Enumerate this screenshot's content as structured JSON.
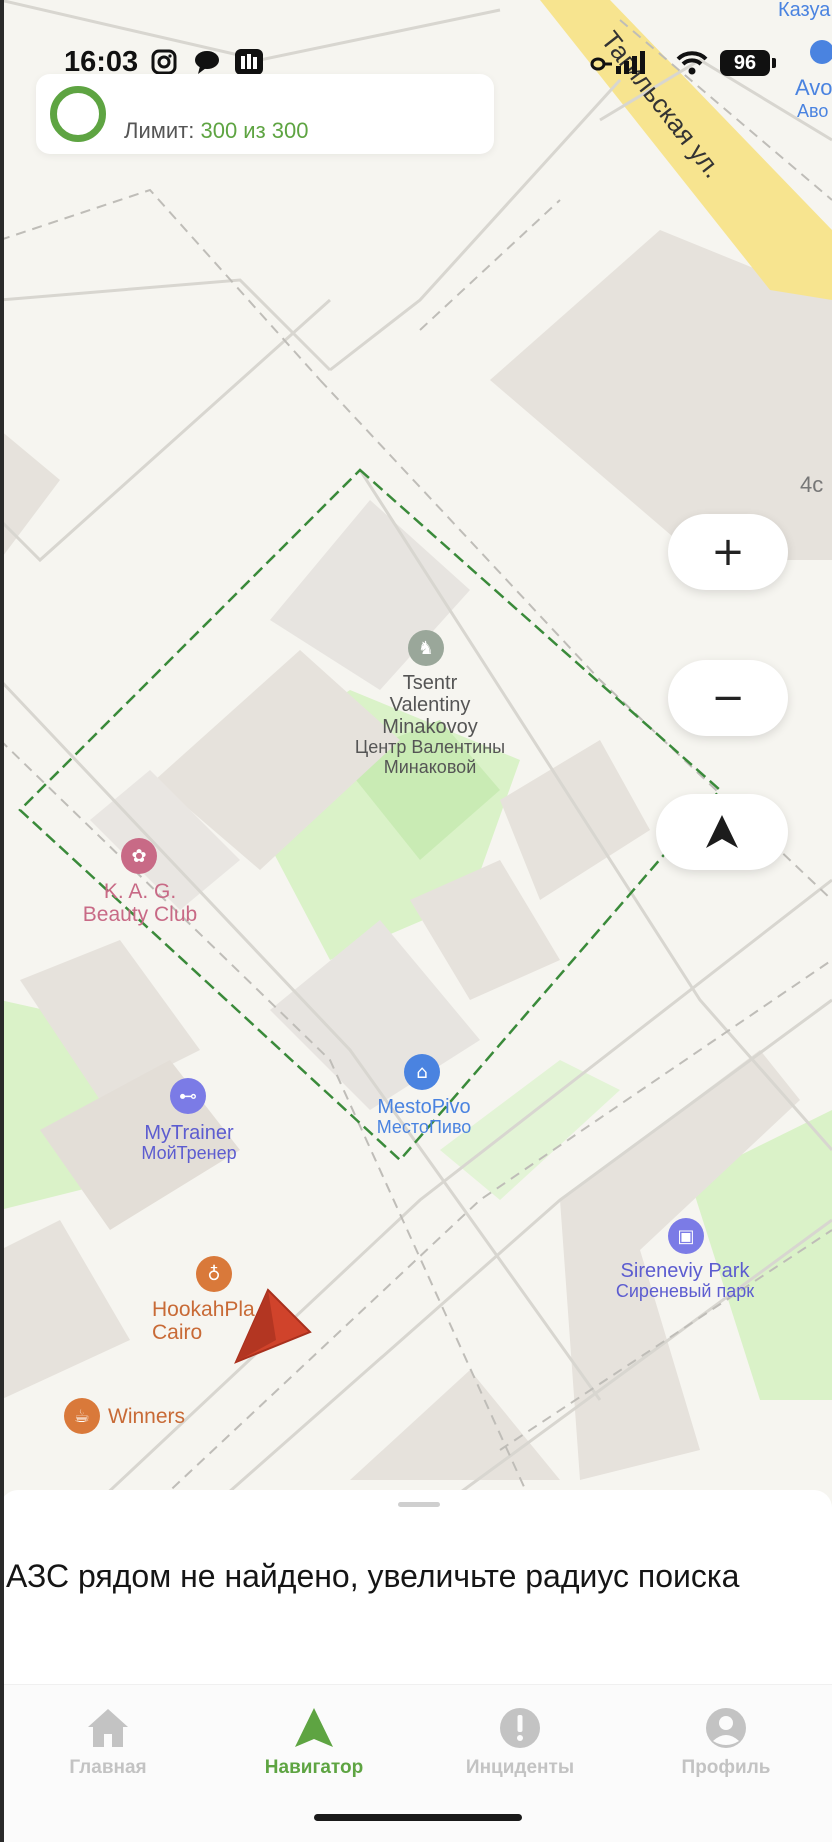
{
  "status_bar": {
    "time": "16:03",
    "battery": "96",
    "icons": [
      "instagram-icon",
      "chat-bubble-icon",
      "app-icon",
      "cellular-signal-icon",
      "wifi-icon",
      "battery-icon"
    ]
  },
  "limit": {
    "label": "Лимит:",
    "value": "300 из 300",
    "fraction": 1.0,
    "accent_color": "#5ea442"
  },
  "map": {
    "street_label": "Тагильская ул.",
    "building_number": "4с",
    "edge_labels": [
      "Казуа",
      "Avo",
      "Аво"
    ],
    "pois": [
      {
        "name_lat": "Tsentr Valentiny Minakovoy",
        "name_lat_lines": [
          "Tsentr",
          "Valentiny",
          "Minakovoy"
        ],
        "name_ru_lines": [
          "Центр Валентины",
          "Минаковой"
        ],
        "icon": "rocking-horse-icon"
      },
      {
        "name_lines": [
          "K. A. G.",
          "Beauty Club"
        ],
        "icon": "lotus-icon",
        "color": "#c86a86"
      },
      {
        "name_lat": "MestoPivo",
        "name_ru": "МестоПиво",
        "icon": "shopping-bag-icon",
        "color": "#4a83e0"
      },
      {
        "name_lat": "MyTrainer",
        "name_ru": "МойТренер",
        "icon": "dumbbell-icon",
        "color": "#7b7be6"
      },
      {
        "name_lines": [
          "HookahPla",
          "Cairo"
        ],
        "icon": "wine-glass-icon",
        "color": "#d9793a"
      },
      {
        "name": "Winners",
        "icon": "coffee-cup-icon",
        "color": "#d9793a"
      },
      {
        "name_lat": "Sireneviy Park",
        "name_ru": "Сиреневый парк",
        "icon": "briefcase-icon",
        "color": "#7b7be6"
      }
    ]
  },
  "controls": {
    "zoom_in": "+",
    "zoom_out": "−"
  },
  "sheet": {
    "message": "АЗС рядом не найдено, увеличьте радиус поиска"
  },
  "nav": {
    "items": [
      {
        "label": "Главная",
        "icon": "home-icon",
        "active": false
      },
      {
        "label": "Навигатор",
        "icon": "navigator-arrow-icon",
        "active": true
      },
      {
        "label": "Инциденты",
        "icon": "exclamation-icon",
        "active": false
      },
      {
        "label": "Профиль",
        "icon": "profile-icon",
        "active": false
      }
    ]
  },
  "colors": {
    "accent": "#5ea442",
    "map_bg": "#f6f5f0",
    "building": "#e6e2dc",
    "park": "#daf2c8",
    "road_yellow": "#f7e48f",
    "location_marker": "#d0432b"
  }
}
